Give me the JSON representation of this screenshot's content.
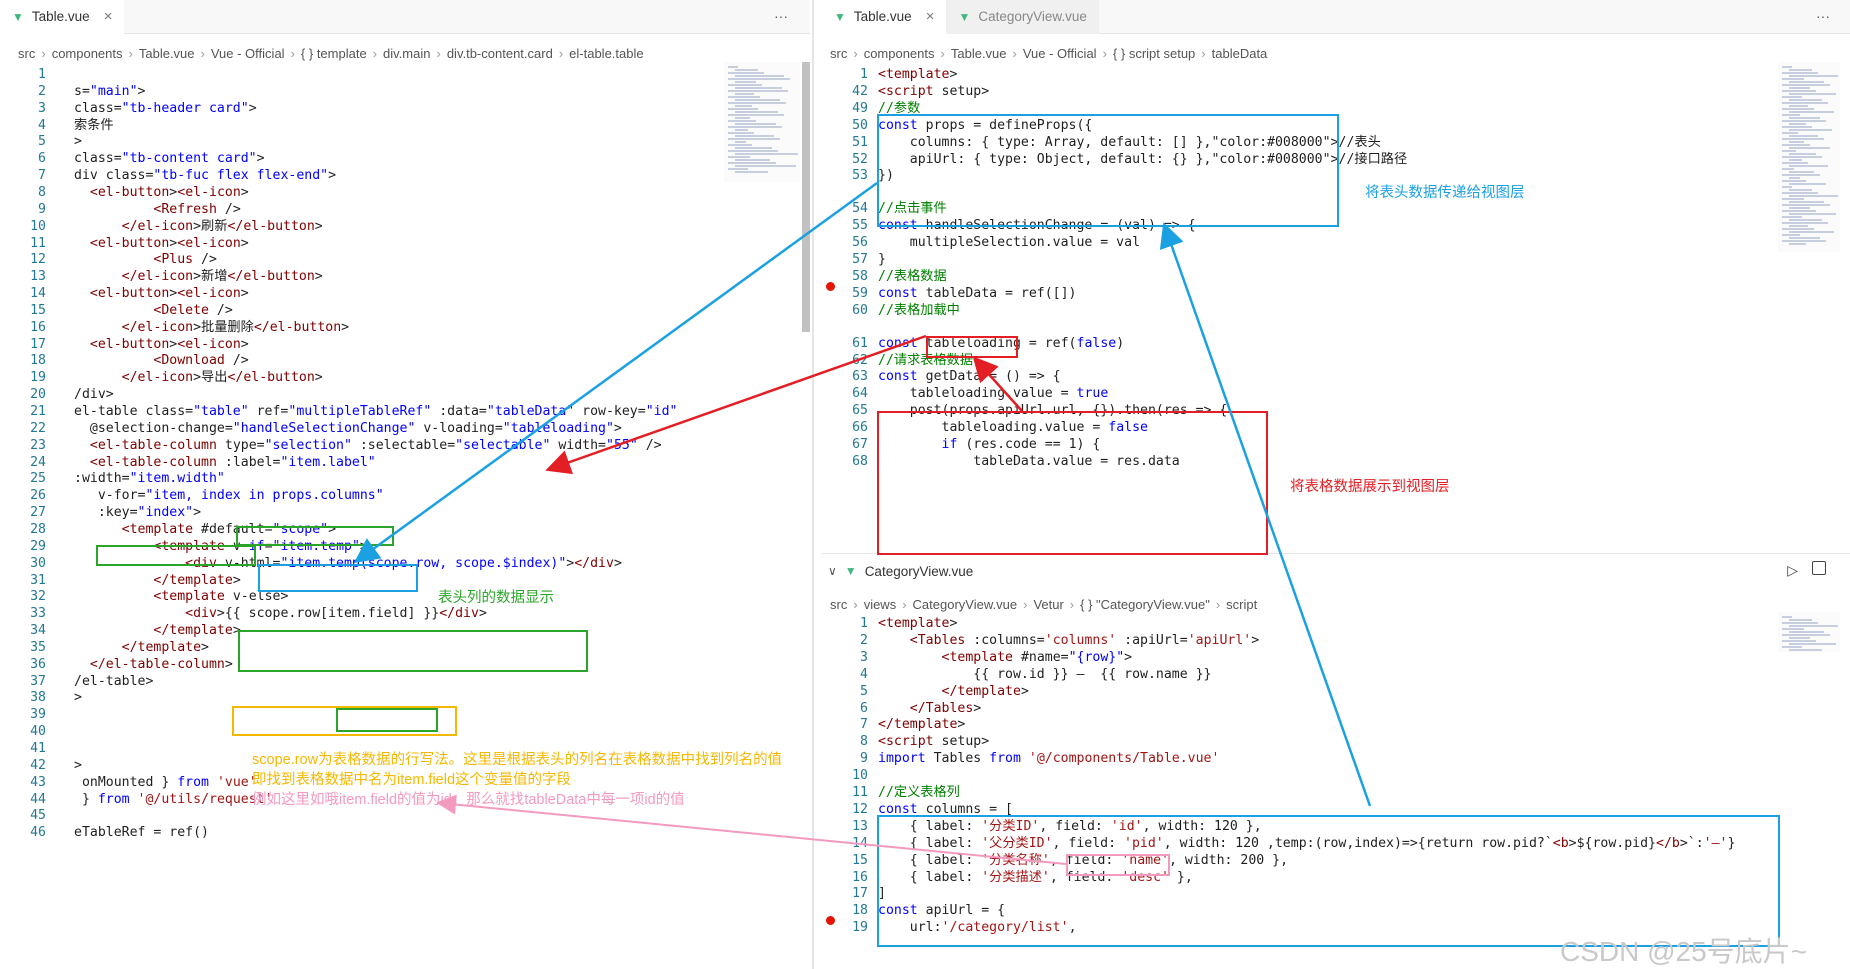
{
  "left": {
    "tab": {
      "label": "Table.vue",
      "close": "×",
      "more": "···"
    },
    "crumbs": [
      "src",
      "components",
      "Table.vue",
      "Vue - Official",
      "{ } template",
      "div.main",
      "div.tb-content.card",
      "el-table.table"
    ],
    "lines": [
      {
        "n": "1",
        "t": ""
      },
      {
        "n": "2",
        "t": "s=\"main\">"
      },
      {
        "n": "3",
        "t": "class=\"tb-header card\">"
      },
      {
        "n": "4",
        "t": "索条件"
      },
      {
        "n": "5",
        "t": ">"
      },
      {
        "n": "6",
        "t": "class=\"tb-content card\">"
      },
      {
        "n": "7",
        "t": "div class=\"tb-fuc flex flex-end\">"
      },
      {
        "n": "8",
        "t": "  <el-button><el-icon>"
      },
      {
        "n": "9",
        "t": "          <Refresh />"
      },
      {
        "n": "10",
        "t": "      </el-icon>刷新</el-button>"
      },
      {
        "n": "11",
        "t": "  <el-button><el-icon>"
      },
      {
        "n": "12",
        "t": "          <Plus />"
      },
      {
        "n": "13",
        "t": "      </el-icon>新增</el-button>"
      },
      {
        "n": "14",
        "t": "  <el-button><el-icon>"
      },
      {
        "n": "15",
        "t": "          <Delete />"
      },
      {
        "n": "16",
        "t": "      </el-icon>批量删除</el-button>"
      },
      {
        "n": "17",
        "t": "  <el-button><el-icon>"
      },
      {
        "n": "18",
        "t": "          <Download />"
      },
      {
        "n": "19",
        "t": "      </el-icon>导出</el-button>"
      },
      {
        "n": "20",
        "t": "/div>"
      },
      {
        "n": "21",
        "t": "el-table class=\"table\" ref=\"multipleTableRef\" :data=\"tableData\" row-key=\"id\""
      },
      {
        "n": "22",
        "t": "  @selection-change=\"handleSelectionChange\" v-loading=\"tableloading\">"
      },
      {
        "n": "23",
        "t": "  <el-table-column type=\"selection\" :selectable=\"selectable\" width=\"55\" />"
      },
      {
        "n": "24",
        "t": "  <el-table-column :label=\"item.label\""
      },
      {
        "n": "25",
        "t": ":width=\"item.width\""
      },
      {
        "n": "26",
        "t": "   v-for=\"item, index in props.columns\""
      },
      {
        "n": "27",
        "t": "   :key=\"index\">"
      },
      {
        "n": "28",
        "t": "      <template #default=\"scope\">"
      },
      {
        "n": "29",
        "t": "          <template v-if=\"item.temp\">"
      },
      {
        "n": "30",
        "t": "              <div v-html=\"item.temp(scope.row, scope.$index)\"></div>"
      },
      {
        "n": "31",
        "t": "          </template>"
      },
      {
        "n": "32",
        "t": "          <template v-else>"
      },
      {
        "n": "33",
        "t": "              <div>{{ scope.row[item.field] }}</div>"
      },
      {
        "n": "34",
        "t": "          </template>"
      },
      {
        "n": "35",
        "t": "      </template>"
      },
      {
        "n": "36",
        "t": "  </el-table-column>"
      },
      {
        "n": "37",
        "t": "/el-table>"
      },
      {
        "n": "38",
        "t": ">"
      },
      {
        "n": "39",
        "t": ""
      },
      {
        "n": "40",
        "t": ""
      },
      {
        "n": "41",
        "t": ""
      },
      {
        "n": "42",
        "t": ">"
      },
      {
        "n": "43",
        "t": " onMounted } from 'vue'"
      },
      {
        "n": "44",
        "t": " } from '@/utils/request'"
      },
      {
        "n": "45",
        "t": ""
      },
      {
        "n": "46",
        "t": "eTableRef = ref()"
      }
    ]
  },
  "right_top": {
    "tabs": [
      {
        "label": "Table.vue",
        "close": "×"
      },
      {
        "label": "CategoryView.vue"
      }
    ],
    "more": "···",
    "crumbs": [
      "src",
      "components",
      "Table.vue",
      "Vue - Official",
      "{ } script setup",
      "tableData"
    ],
    "lines": [
      {
        "n": "1",
        "t": "<template>"
      },
      {
        "n": "42",
        "t": "<script setup>"
      },
      {
        "n": "49",
        "t": "//参数"
      },
      {
        "n": "50",
        "t": "const props = defineProps({"
      },
      {
        "n": "51",
        "t": "    columns: { type: Array, default: [] },//表头"
      },
      {
        "n": "52",
        "t": "    apiUrl: { type: Object, default: {} },//接口路径"
      },
      {
        "n": "53",
        "t": "})"
      },
      {
        "n": "54",
        "t": "//点击事件"
      },
      {
        "n": "55",
        "t": "const handleSelectionChange = (val) => {"
      },
      {
        "n": "56",
        "t": "    multipleSelection.value = val"
      },
      {
        "n": "57",
        "t": "}"
      },
      {
        "n": "58",
        "t": "//表格数据"
      },
      {
        "n": "59",
        "t": "const tableData = ref([])"
      },
      {
        "n": "60",
        "t": "//表格加载中"
      },
      {
        "n": "61",
        "t": "const tableloading = ref(false)"
      },
      {
        "n": "62",
        "t": "//请求表格数据"
      },
      {
        "n": "63",
        "t": "const getData = () => {"
      },
      {
        "n": "64",
        "t": "    tableloading.value = true"
      },
      {
        "n": "65",
        "t": "    post(props.apiUrl.url, {}).then(res => {"
      },
      {
        "n": "66",
        "t": "        tableloading.value = false"
      },
      {
        "n": "67",
        "t": "        if (res.code == 1) {"
      },
      {
        "n": "68",
        "t": "            tableData.value = res.data"
      }
    ]
  },
  "right_bottom": {
    "tab": {
      "label": "CategoryView.vue",
      "chevron": "∨"
    },
    "crumbs": [
      "src",
      "views",
      "CategoryView.vue",
      "Vetur",
      "{ } \"CategoryView.vue\"",
      "script"
    ],
    "lines": [
      {
        "n": "1",
        "t": "<template>"
      },
      {
        "n": "2",
        "t": "    <Tables :columns='columns' :apiUrl='apiUrl'>"
      },
      {
        "n": "3",
        "t": "        <template #name=\"{row}\">"
      },
      {
        "n": "4",
        "t": "            {{ row.id }} —  {{ row.name }}"
      },
      {
        "n": "5",
        "t": "        </template>"
      },
      {
        "n": "6",
        "t": "    </Tables>"
      },
      {
        "n": "7",
        "t": "</template>"
      },
      {
        "n": "8",
        "t": "<script setup>"
      },
      {
        "n": "9",
        "t": "import Tables from '@/components/Table.vue'"
      },
      {
        "n": "10",
        "t": ""
      },
      {
        "n": "11",
        "t": "//定义表格列"
      },
      {
        "n": "12",
        "t": "const columns = ["
      },
      {
        "n": "13",
        "t": "    { label: '分类ID', field: 'id', width: 120 },"
      },
      {
        "n": "14",
        "t": "    { label: '父分类ID', field: 'pid', width: 120 ,temp:(row,index)=>{return row.pid?`<b>${row.pid}</b>`:'—'}"
      },
      {
        "n": "15",
        "t": "    { label: '分类名称', field: 'name', width: 200 },"
      },
      {
        "n": "16",
        "t": "    { label: '分类描述', field: 'desc' },"
      },
      {
        "n": "17",
        "t": "]"
      },
      {
        "n": "18",
        "t": "const apiUrl = {"
      },
      {
        "n": "19",
        "t": "    url:'/category/list',"
      }
    ]
  },
  "annotations": {
    "props_to_view": "将表头数据传递给视图层",
    "data_to_view": "将表格数据展示到视图层",
    "header_display": "表头列的数据显示",
    "explain_1": "scope.row为表格数据的行写法。这里是根据表头的列名在表格数据中找到列名的值",
    "explain_2": "即找到表格数据中名为item.field这个变量值的字段",
    "explain_3": "例如这里如哦item.field的值为id，那么就找tableData中每一项id的值"
  },
  "watermark": "CSDN @25号底片~",
  "colors": {
    "blue": "#1ba1e2",
    "red": "#e31e24",
    "green": "#2aa52a",
    "yellow": "#f5b800",
    "pink": "#f49ac1",
    "keyword": "#0000ff",
    "tag": "#800000",
    "attr": "#e50000",
    "string": "#a31515",
    "comment": "#008000",
    "linenum": "#237893"
  }
}
